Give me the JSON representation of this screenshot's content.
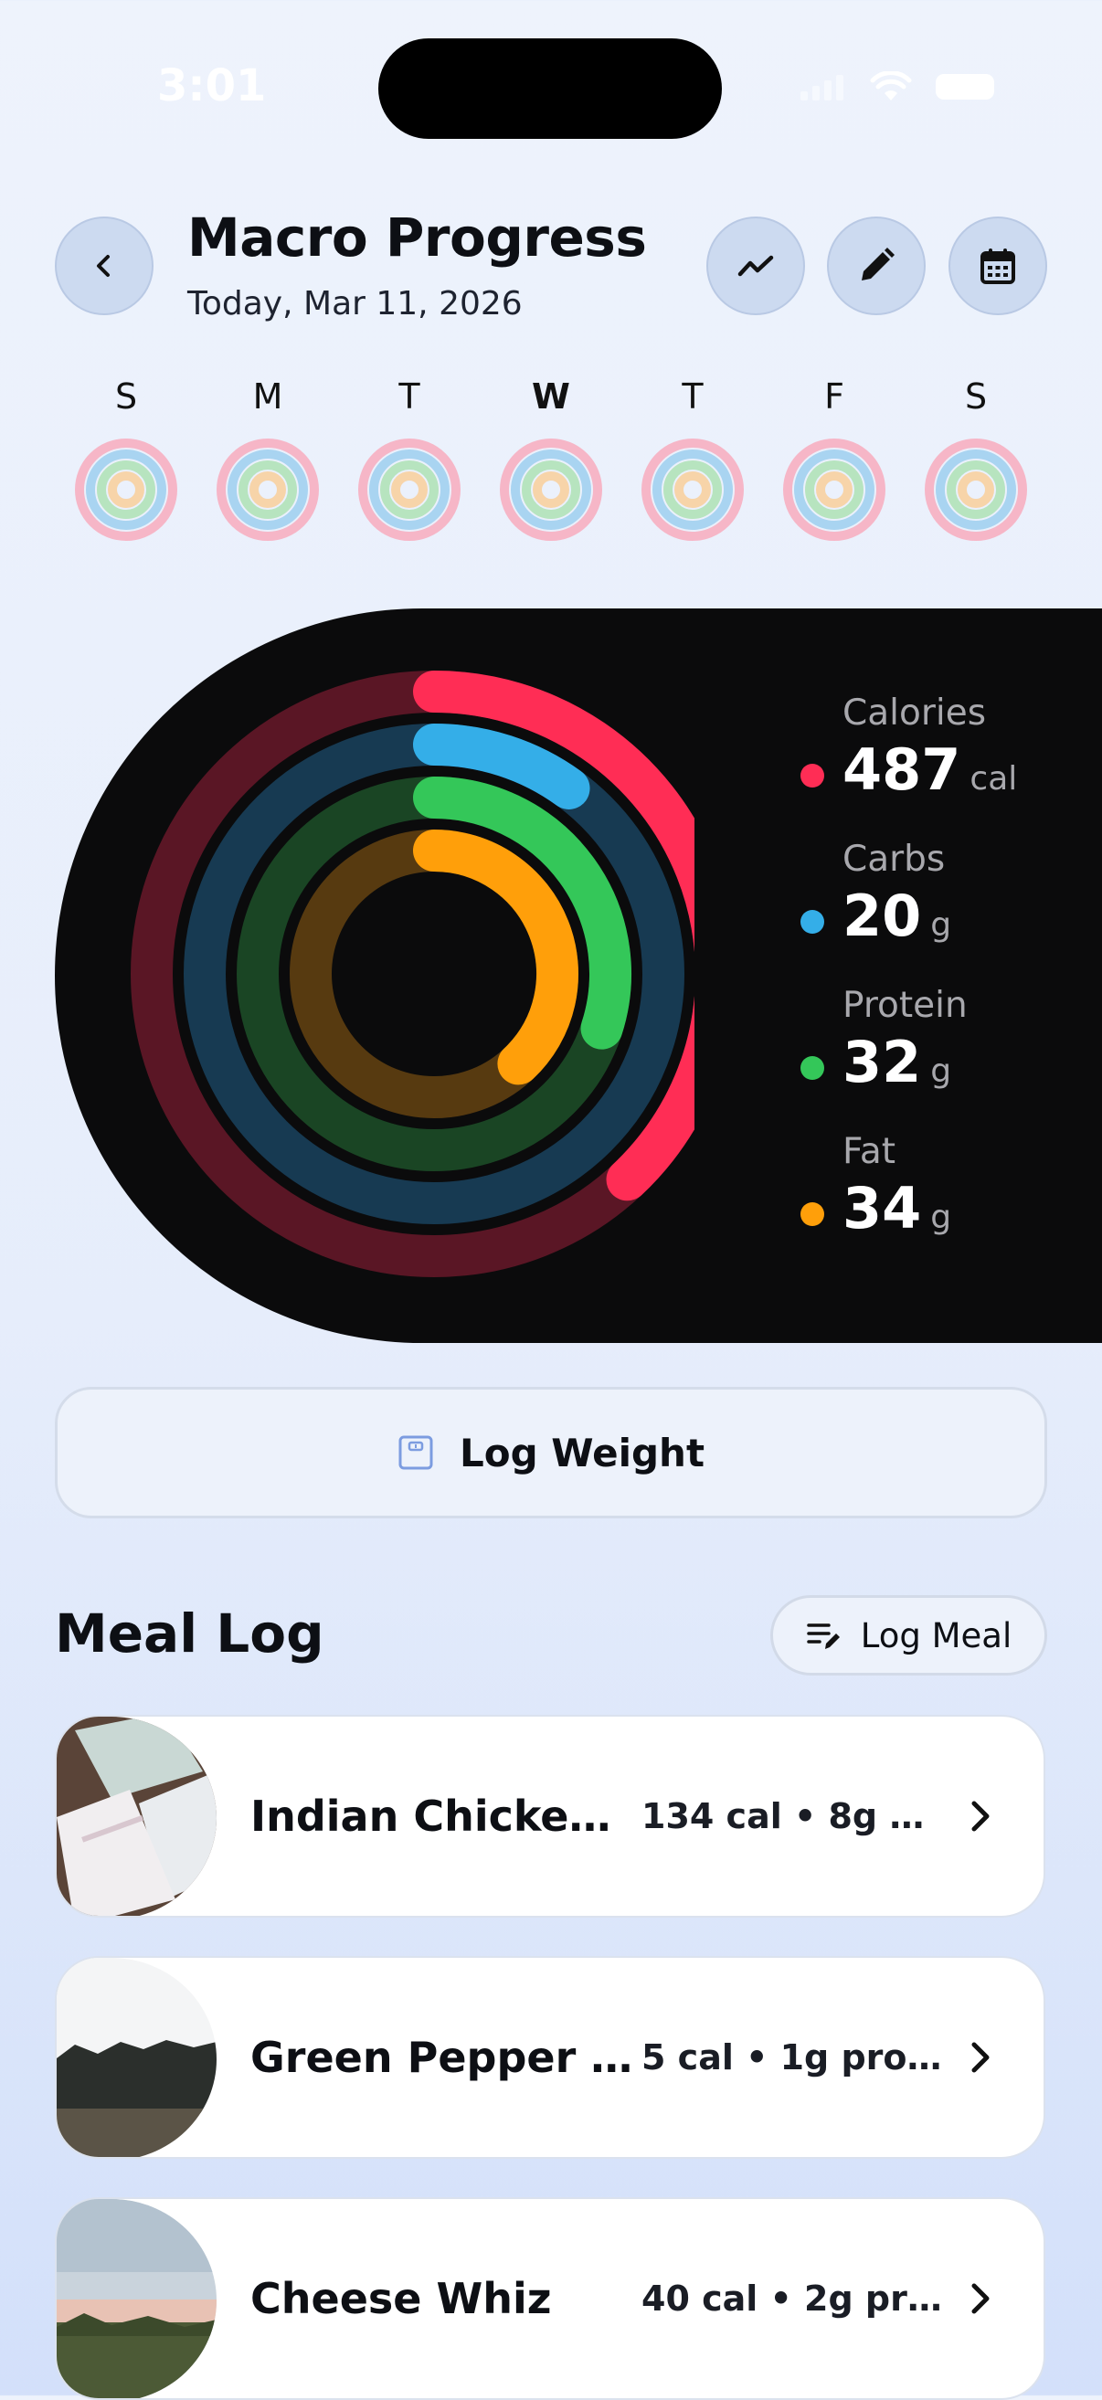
{
  "status_bar": {
    "time": "3:01"
  },
  "header": {
    "title": "Macro Progress",
    "subtitle": "Today, Mar 11, 2026",
    "icons": [
      "chevron-left-icon",
      "trend-icon",
      "pencil-icon",
      "calendar-icon"
    ]
  },
  "week": {
    "days": [
      {
        "letter": "S",
        "active": false
      },
      {
        "letter": "M",
        "active": false
      },
      {
        "letter": "T",
        "active": false
      },
      {
        "letter": "W",
        "active": true
      },
      {
        "letter": "T",
        "active": false
      },
      {
        "letter": "F",
        "active": false
      },
      {
        "letter": "S",
        "active": false
      }
    ]
  },
  "macros": [
    {
      "label": "Calories",
      "value": "487",
      "unit": "cal",
      "color": "#ff2d55",
      "track": "#5a1625",
      "progress": 0.38
    },
    {
      "label": "Carbs",
      "value": "20",
      "unit": "g",
      "color": "#34aee8",
      "track": "#173a52",
      "progress": 0.1
    },
    {
      "label": "Protein",
      "value": "32",
      "unit": "g",
      "color": "#34c759",
      "track": "#1a4524",
      "progress": 0.3
    },
    {
      "label": "Fat",
      "value": "34",
      "unit": "g",
      "color": "#ff9f0a",
      "track": "#573a10",
      "progress": 0.38
    }
  ],
  "log_weight": {
    "label": "Log Weight"
  },
  "meal_log": {
    "title": "Meal Log",
    "log_meal_label": "Log Meal",
    "meals": [
      {
        "name": "Indian Chicken...",
        "stats": "134 cal • 8g pr..."
      },
      {
        "name": "Green Pepper S...",
        "stats": "5 cal • 1g prot..."
      },
      {
        "name": "Cheese Whiz",
        "stats": "40 cal • 2g pro..."
      }
    ]
  }
}
